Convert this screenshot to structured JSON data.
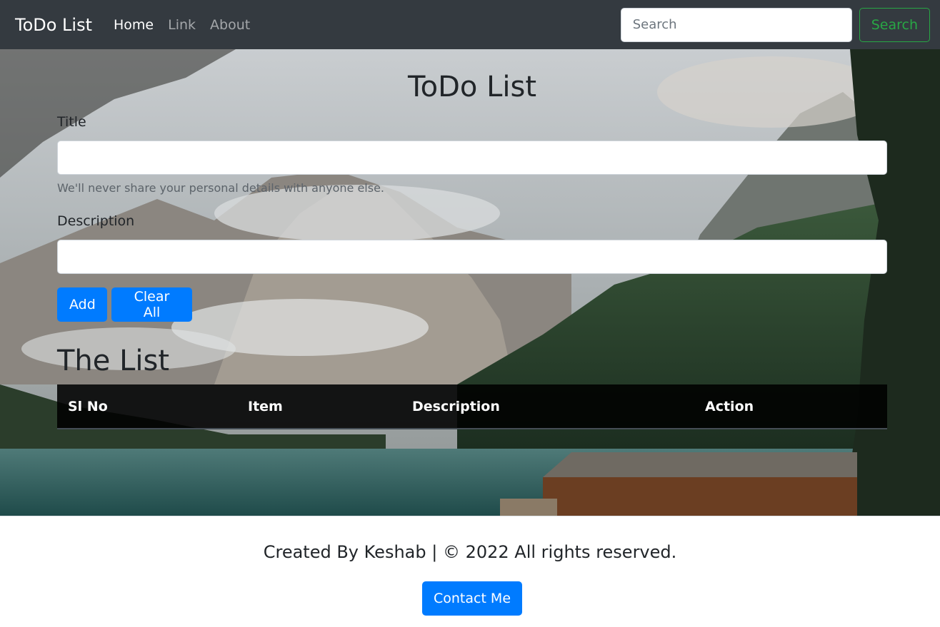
{
  "navbar": {
    "brand": "ToDo List",
    "links": [
      {
        "label": "Home",
        "active": true
      },
      {
        "label": "Link",
        "active": false
      },
      {
        "label": "About",
        "active": false
      }
    ],
    "search_placeholder": "Search",
    "search_button": "Search"
  },
  "form": {
    "heading": "ToDo List",
    "title_label": "Title",
    "title_value": "",
    "help_text": "We'll never share your personal details with anyone else.",
    "description_label": "Description",
    "description_value": "",
    "add_button": "Add",
    "clear_button": "Clear All"
  },
  "list": {
    "heading": "The List",
    "columns": [
      "Sl No",
      "Item",
      "Description",
      "Action"
    ],
    "rows": []
  },
  "footer": {
    "text": "Created By Keshab |  ©   2022 All rights reserved.",
    "contact_button": "Contact Me"
  },
  "colors": {
    "navbar_bg": "#343a40",
    "primary": "#007bff",
    "success": "#28a745"
  }
}
